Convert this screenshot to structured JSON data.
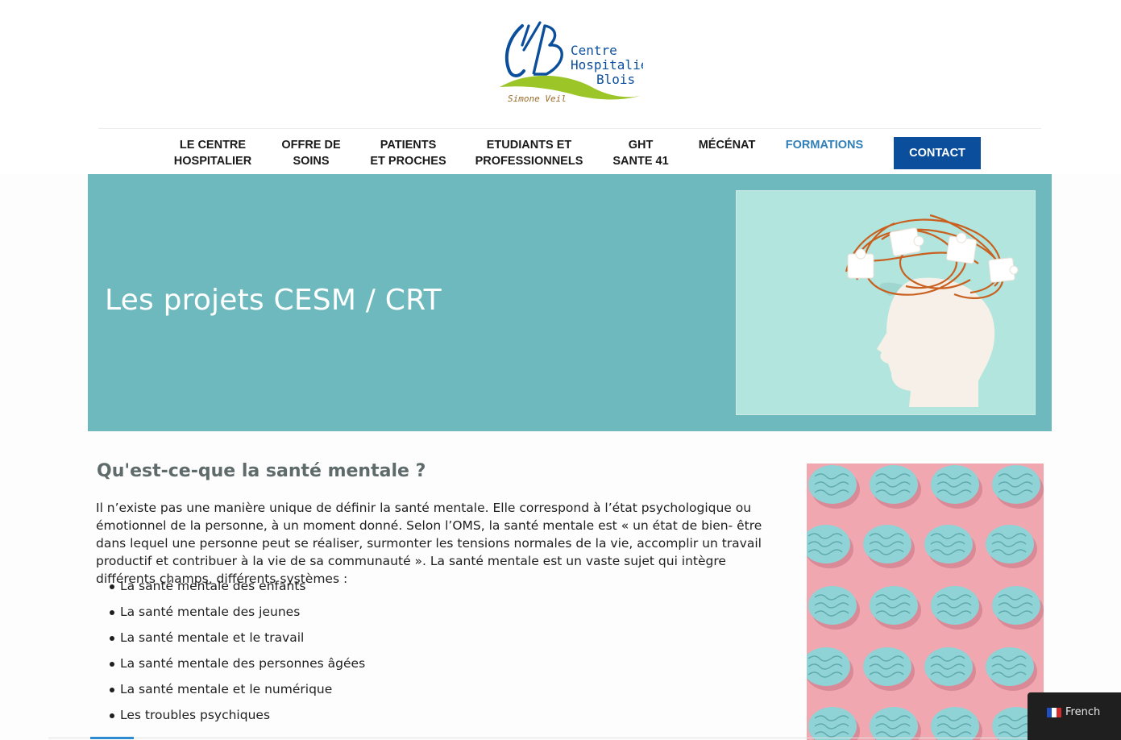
{
  "brand": {
    "logo_monogram": "CHB",
    "logo_line1": "Centre",
    "logo_line2": "Hospitalier",
    "logo_line3": "Blois",
    "logo_signature": "Simone Veil",
    "colors": {
      "blue": "#0b4f9c",
      "green": "#9cc628",
      "signature": "#9a6a2a"
    }
  },
  "nav": {
    "items": [
      {
        "label": "LE CENTRE\nHOSPITALIER",
        "active": false
      },
      {
        "label": "OFFRE DE\nSOINS",
        "active": false
      },
      {
        "label": "PATIENTS\nET PROCHES",
        "active": false
      },
      {
        "label": "ETUDIANTS ET\nPROFESSIONNELS",
        "active": false
      },
      {
        "label": "GHT\nSANTE 41",
        "active": false
      },
      {
        "label": "MÉCÉNAT",
        "active": false
      },
      {
        "label": "FORMATIONS",
        "active": true
      }
    ],
    "contact_label": "CONTACT",
    "active_color": "#2f7fb8",
    "contact_color": "#0b4f9c"
  },
  "hero": {
    "title": "Les projets CESM / CRT",
    "background_color": "#6db9bd",
    "image_icon": "head-silhouette-with-puzzle-pieces"
  },
  "content": {
    "heading": "Qu'est-ce-que la santé mentale ?",
    "intro": "Il n’existe pas une manière unique de définir la santé mentale. Elle correspond à l’état psychologique ou émotionnel de la personne, à un moment donné. Selon l’OMS, la santé mentale est « un état de bien- être dans lequel une personne peut se réaliser, surmonter les tensions normales de la vie, accomplir un travail productif et contribuer à la vie de sa communauté ». La santé mentale est un vaste sujet qui intègre différents champs, différents systèmes :",
    "bullets": [
      "La santé mentale des enfants",
      "La santé mentale des jeunes",
      "La santé mentale et le travail",
      "La santé mentale des personnes âgées",
      "La santé mentale et le numérique",
      "Les troubles psychiques"
    ],
    "side_image_icon": "brains-pattern-pink-background"
  },
  "language_switcher": {
    "label": "French",
    "flag_icon": "french-flag-icon"
  }
}
